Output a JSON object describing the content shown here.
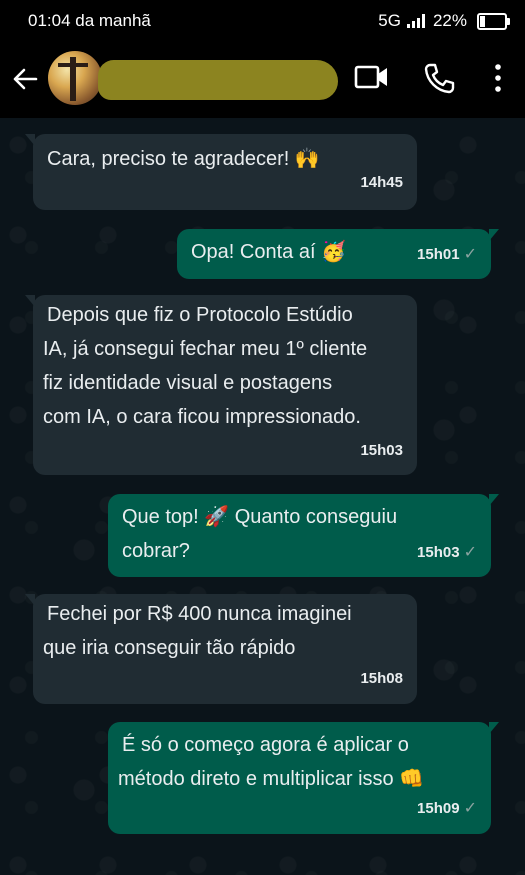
{
  "status_bar": {
    "time": "01:04 da manhã",
    "network": "5G",
    "battery": "22%",
    "battery_level": 0.22
  },
  "header": {
    "contact_name": "",
    "icons": [
      "back-arrow-icon",
      "video-call-icon",
      "phone-icon",
      "more-options-icon"
    ]
  },
  "messages": [
    {
      "direction": "in",
      "text": "Cara, preciso te agradecer! 🙌",
      "time": "14h45"
    },
    {
      "direction": "out",
      "text": "Opa! Conta aí 🥳",
      "time": "15h01",
      "status": "✓"
    },
    {
      "direction": "in",
      "lines": [
        "Depois que fiz o Protocolo Estúdio",
        "IA, já consegui fechar meu 1º cliente",
        "fiz identidade visual e postagens",
        "com IA, o cara ficou impressionado."
      ],
      "time": "15h03"
    },
    {
      "direction": "out",
      "lines": [
        "Que top! 🚀 Quanto conseguiu",
        "cobrar?"
      ],
      "time": "15h03",
      "status": "✓"
    },
    {
      "direction": "in",
      "lines": [
        "Fechei por R$ 400 nunca imaginei",
        "que iria conseguir tão rápido"
      ],
      "time": "15h08"
    },
    {
      "direction": "out",
      "lines": [
        "É só o começo agora é aplicar o",
        "método direto e multiplicar isso 👊"
      ],
      "time": "15h09",
      "status": "✓"
    }
  ],
  "colors": {
    "incoming_bubble": "#202c33",
    "outgoing_bubble": "#005c4b",
    "background": "#0b141a",
    "redaction": "#8c8420"
  }
}
